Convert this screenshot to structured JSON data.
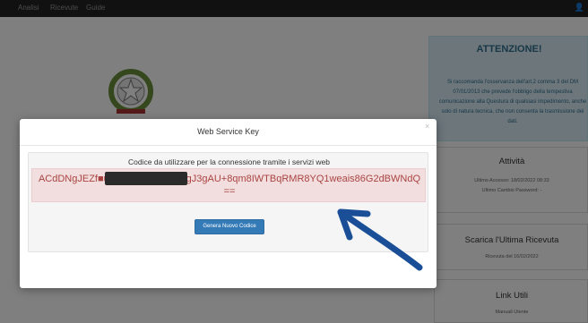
{
  "navbar": {
    "items": [
      "Analisi",
      "Ricevute",
      "Guide"
    ],
    "user_icon": "user-icon"
  },
  "attention": {
    "title": "ATTENZIONE!",
    "text": "Si raccomanda l'osservanza dell'art.2 comma 3 del DM 07/01/2013 che prevede l'obbligo della tempestiva comunicazione alla Questura di qualsiasi impedimento, anche solo di natura tecnica, che non consenta la trasmissione dei dati."
  },
  "activity": {
    "title": "Attività",
    "last_access": "Ultimo Accesso: 18/02/2022 08:33",
    "last_password_change": "Ultimo Cambio Password: -"
  },
  "receipt": {
    "title": "Scarica l'Ultima Ricevuta",
    "text": "Ricevuta del 16/02/2022"
  },
  "links": {
    "title": "Link Utili",
    "text": "Manuali Utente"
  },
  "modal": {
    "title": "Web Service Key",
    "close": "×",
    "instructions": "Codice da utilizzare per la connessione tramite i servizi web",
    "key": "ACdDNgJEZf■■■■■■■■■■■■jfX3gJ3gAU+8qm8IWTBqRMR8YQ1weais86G2dBWNdQ==",
    "generate_button": "Genera Nuovo Codice"
  },
  "colors": {
    "navbar": "#222222",
    "attention_bg": "#d9edf7",
    "key_bg": "#f2dede",
    "key_text": "#a94442",
    "button": "#337ab7",
    "annotation_arrow": "#1a4f97"
  }
}
